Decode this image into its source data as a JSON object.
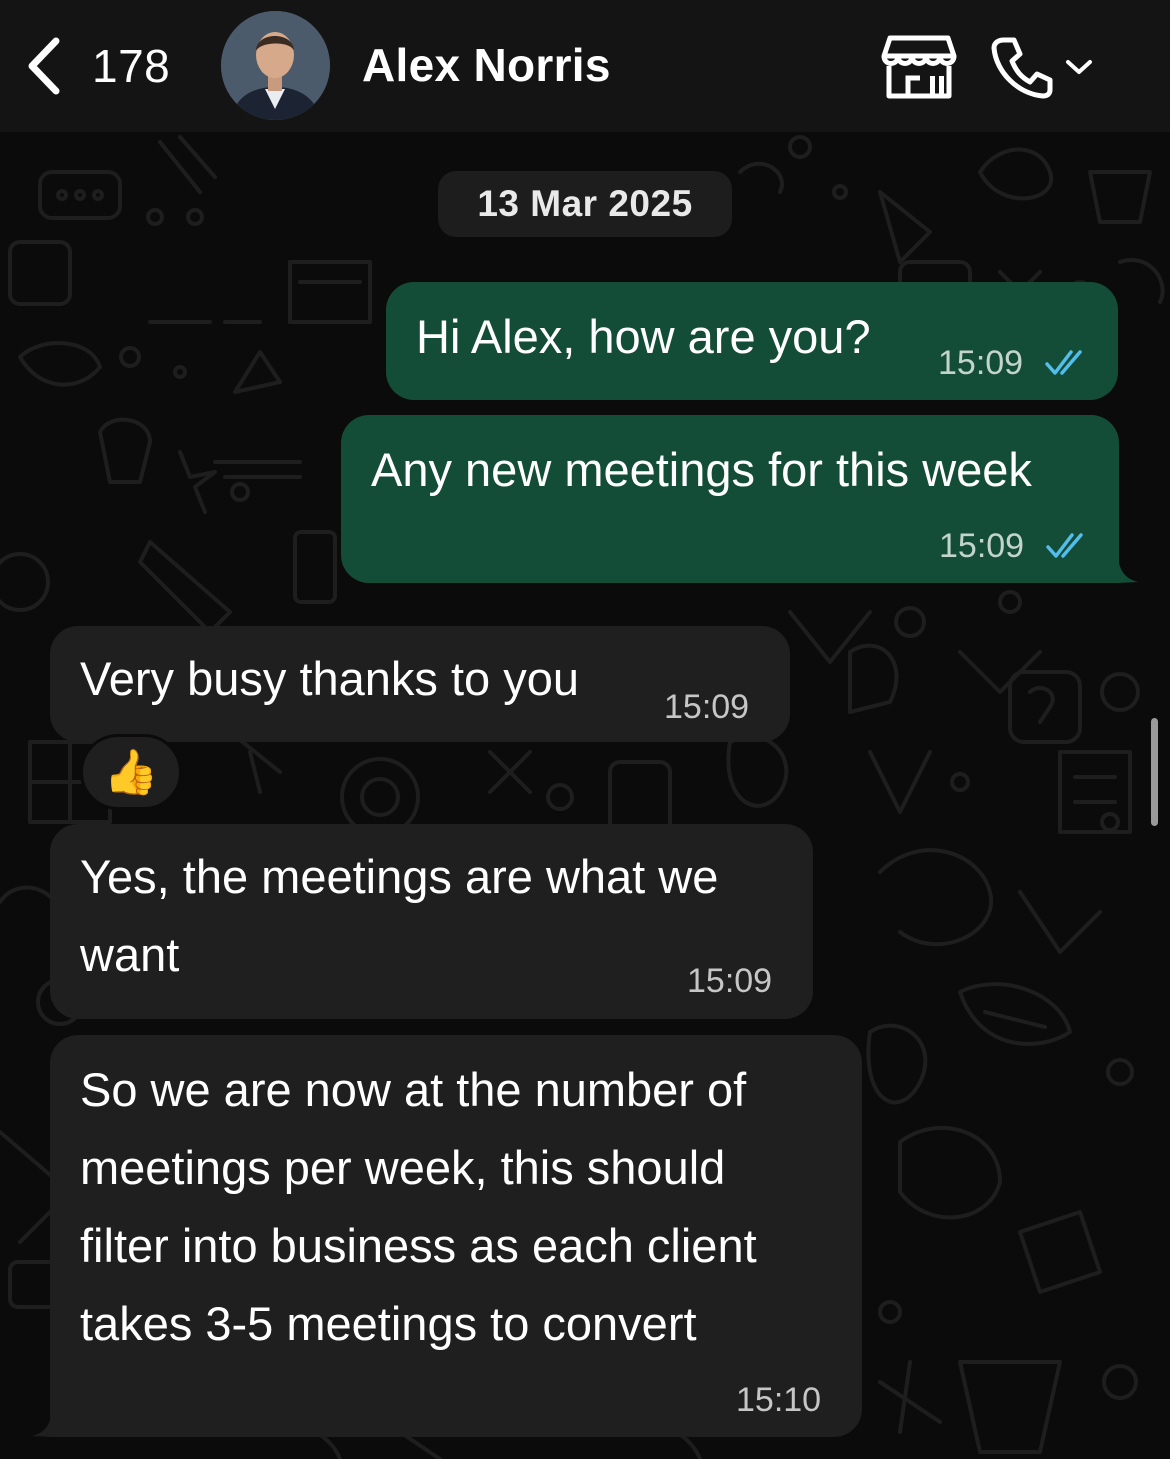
{
  "header": {
    "back_count": "178",
    "contact_name": "Alex Norris"
  },
  "chat": {
    "date_label": "13 Mar 2025",
    "messages": [
      {
        "direction": "outgoing",
        "text": "Hi Alex, how are you?",
        "time": "15:09",
        "status": "read"
      },
      {
        "direction": "outgoing",
        "text": "Any new meetings for this week",
        "time": "15:09",
        "status": "read"
      },
      {
        "direction": "incoming",
        "text": "Very busy thanks to you",
        "time": "15:09",
        "reaction": "👍"
      },
      {
        "direction": "incoming",
        "lines": [
          "Yes, the meetings are what we",
          "want"
        ],
        "time": "15:09"
      },
      {
        "direction": "incoming",
        "lines": [
          "So we are now at the number of",
          "meetings per week, this should",
          "filter into business as each client",
          "takes 3-5 meetings to convert"
        ],
        "time": "15:10"
      }
    ]
  },
  "colors": {
    "header_bg": "#141414",
    "chat_bg": "#0b0b0b",
    "outgoing_bubble": "#144d37",
    "incoming_bubble": "#1f1f1f",
    "read_tick": "#53bdeb"
  },
  "icons": {
    "back": "chevron-left-icon",
    "shop": "storefront-icon",
    "call": "phone-icon",
    "call_menu": "chevron-down-icon",
    "read_status": "double-check-icon"
  }
}
